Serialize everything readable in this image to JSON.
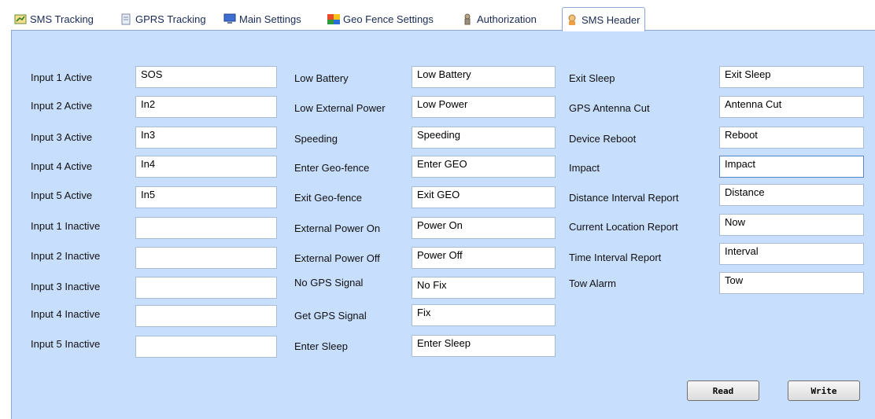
{
  "tabs": [
    {
      "label": "SMS Tracking",
      "icon": "sms-tracking-icon"
    },
    {
      "label": "GPRS Tracking",
      "icon": "gprs-tracking-icon"
    },
    {
      "label": "Main Settings",
      "icon": "monitor-icon"
    },
    {
      "label": "Geo Fence Settings",
      "icon": "geo-fence-icon"
    },
    {
      "label": "Authorization",
      "icon": "authorization-icon"
    },
    {
      "label": "SMS Header",
      "icon": "sms-header-icon",
      "active": true
    }
  ],
  "col1": [
    {
      "label": "Input 1 Active",
      "value": "SOS"
    },
    {
      "label": "Input 2 Active",
      "value": "In2"
    },
    {
      "label": "Input 3 Active",
      "value": "In3"
    },
    {
      "label": "Input 4 Active",
      "value": "In4"
    },
    {
      "label": "Input 5 Active",
      "value": "In5"
    },
    {
      "label": "Input 1 Inactive",
      "value": ""
    },
    {
      "label": "Input 2 Inactive",
      "value": ""
    },
    {
      "label": "Input 3 Inactive",
      "value": ""
    },
    {
      "label": "Input 4 Inactive",
      "value": ""
    },
    {
      "label": "Input 5 Inactive",
      "value": ""
    }
  ],
  "col2": [
    {
      "label": "Low Battery",
      "value": "Low Battery"
    },
    {
      "label": "Low External Power",
      "value": "Low Power"
    },
    {
      "label": "Speeding",
      "value": "Speeding"
    },
    {
      "label": "Enter Geo-fence",
      "value": "Enter GEO"
    },
    {
      "label": "Exit Geo-fence",
      "value": "Exit GEO"
    },
    {
      "label": "External Power On",
      "value": "Power On"
    },
    {
      "label": "External Power Off",
      "value": "Power Off"
    },
    {
      "label": "No GPS Signal",
      "value": "No Fix"
    },
    {
      "label": "Get GPS Signal",
      "value": "Fix"
    },
    {
      "label": "Enter Sleep",
      "value": "Enter Sleep"
    }
  ],
  "col3": [
    {
      "label": "Exit Sleep",
      "value": "Exit Sleep"
    },
    {
      "label": "GPS Antenna Cut",
      "value": "Antenna Cut"
    },
    {
      "label": "Device Reboot",
      "value": "Reboot"
    },
    {
      "label": "Impact",
      "value": "Impact"
    },
    {
      "label": "Distance Interval Report",
      "value": "Distance"
    },
    {
      "label": "Current Location Report",
      "value": "Now"
    },
    {
      "label": "Time Interval Report",
      "value": "Interval"
    },
    {
      "label": "Tow Alarm",
      "value": "Tow"
    }
  ],
  "buttons": {
    "read": "Read",
    "write": "Write"
  },
  "colors": {
    "panel": "#c7defc",
    "tab_text": "#1a2a55",
    "border": "#8aa7d4"
  }
}
